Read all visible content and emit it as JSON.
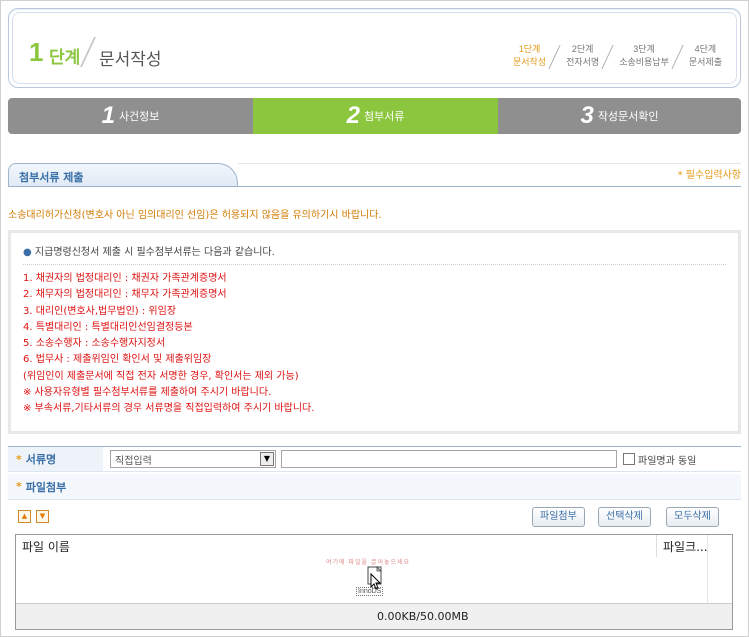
{
  "header": {
    "step_number": "1",
    "step_word": "단계",
    "title": "문서작성",
    "mini_steps": [
      {
        "num": "1단계",
        "label": "문서작성",
        "active": true
      },
      {
        "num": "2단계",
        "label": "전자서명",
        "active": false
      },
      {
        "num": "3단계",
        "label": "소송비용납부",
        "active": false
      },
      {
        "num": "4단계",
        "label": "문서제출",
        "active": false
      }
    ]
  },
  "tabs": [
    {
      "num": "1",
      "label": "사건정보"
    },
    {
      "num": "2",
      "label": "첨부서류"
    },
    {
      "num": "3",
      "label": "작성문서확인"
    }
  ],
  "section": {
    "title": "첨부서류 제출",
    "required_note": "* 필수입력사항"
  },
  "notice": "소송대리허가신청(변호사 아닌 임의대리인 선임)은 허용되지 않음을 유의하기시 바랍니다.",
  "info": {
    "heading": "지급명령신청서 제출 시 필수첨부서류는 다음과 같습니다.",
    "lines": [
      "1. 채권자의 법정대리인 : 채권자 가족관계증명서",
      "2. 채무자의 법정대리인 : 채무자 가족관계증명서",
      "3. 대리인(변호사,법무법인) : 위임장",
      "4. 특별대리인 : 특별대리인선임결정등본",
      "5. 소송수행자 : 소송수행자지정서",
      "6. 법무사 : 제출위임인 확인서 및 제출위임장",
      "   (위임인이 제출문서에 직접 전자 서명한 경우, 확인서는 제외 가능)",
      " ※ 사용자유형별 필수첨부서류를 제출하여 주시기 바랍니다.",
      " ※ 부속서류,기타서류의 경우 서류명을 직접입력하여 주시기 바랍니다."
    ]
  },
  "form": {
    "doc_name_label": "서류명",
    "doc_select_value": "직접입력",
    "same_as_filename_label": "파일명과 동일",
    "file_attach_label": "파일첨부"
  },
  "toolbar": {
    "attach_button": "파일첨부",
    "delete_selected_button": "선택삭제",
    "delete_all_button": "모두삭제"
  },
  "file_list": {
    "col_name": "파일 이름",
    "col_size": "파일크...",
    "ghost_text": "여기에 파일을 끌어놓으세요",
    "drop_label": "InnoDS",
    "total": "0.00KB/50.00MB"
  }
}
